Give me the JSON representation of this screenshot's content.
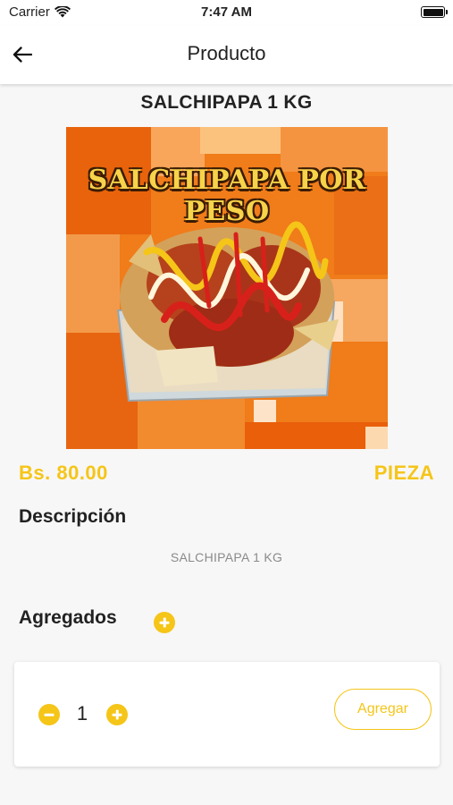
{
  "status_bar": {
    "carrier": "Carrier",
    "time": "7:47 AM"
  },
  "nav": {
    "title": "Producto",
    "back_icon": "arrow-left-icon"
  },
  "product": {
    "name": "SALCHIPAPA 1 KG",
    "image_caption": "SALCHIPAPA POR PESO",
    "price": "Bs. 80.00",
    "unit": "PIEZA",
    "description_title": "Descripción",
    "description": "SALCHIPAPA 1 KG"
  },
  "extras": {
    "title": "Agregados",
    "add_icon": "plus-circle-icon"
  },
  "cart": {
    "quantity": "1",
    "add_label": "Agregar"
  },
  "colors": {
    "accent": "#f5c518",
    "background": "#f7f7f7",
    "text": "#222222",
    "muted": "#8a8a8a"
  }
}
